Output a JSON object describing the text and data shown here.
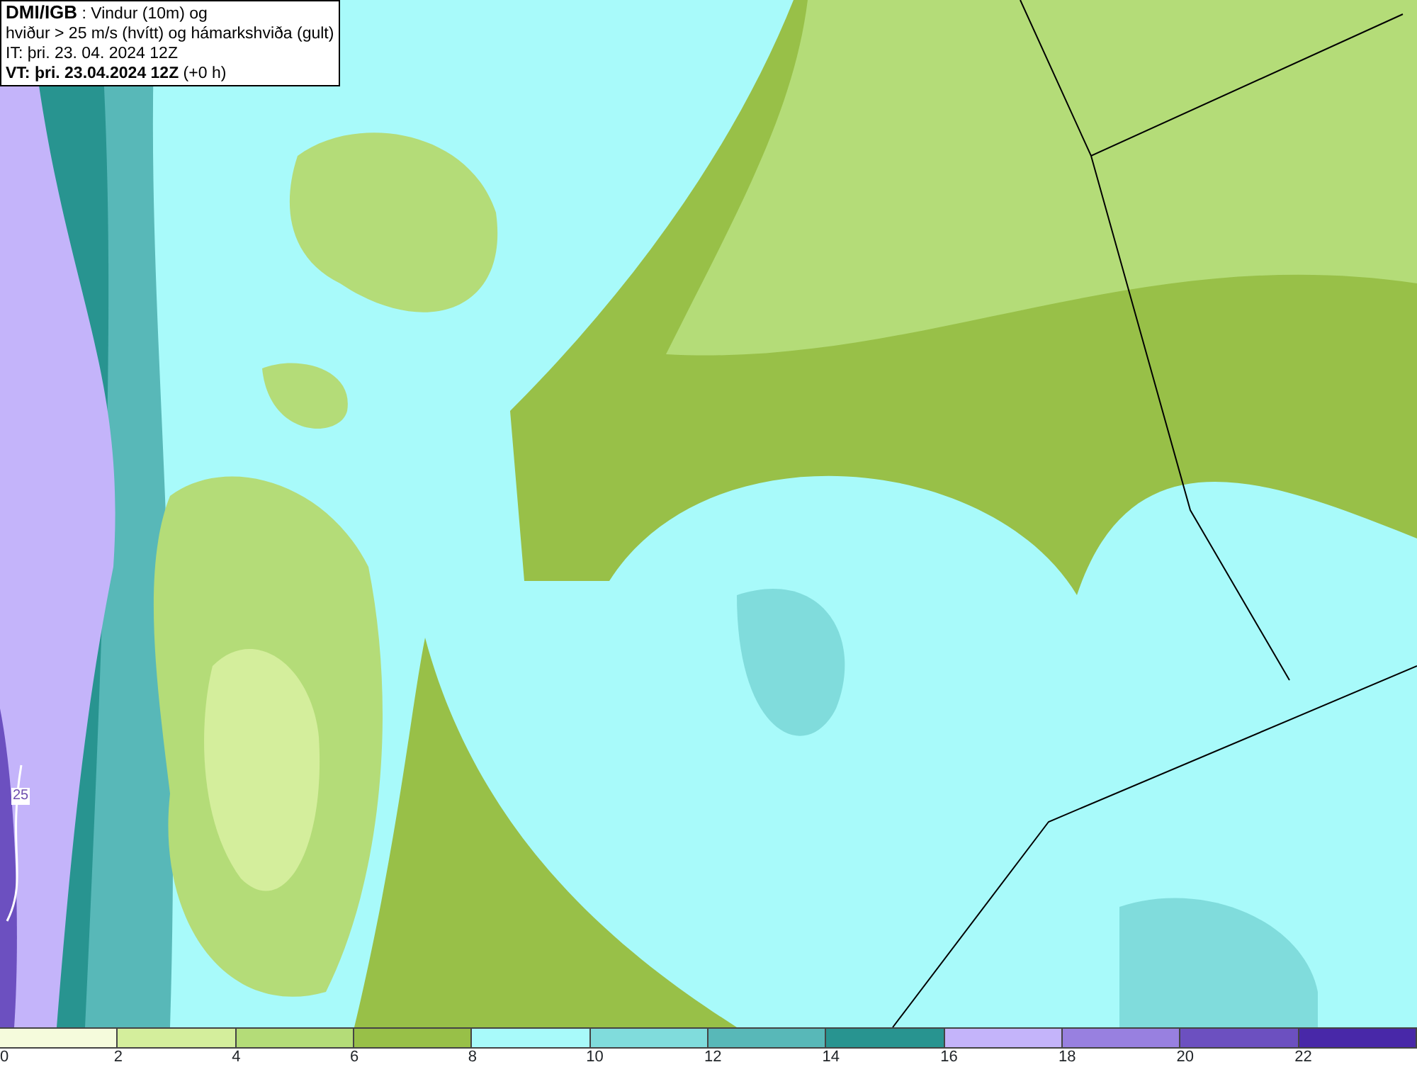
{
  "header": {
    "lines": [
      "**DMI/IGB** : Vindur (10m) og",
      "hviður > 25 m/s (hvítt) og hámarkshviða (gult)",
      "IT: þri. 23. 04. 2024 12Z",
      "**VT: þri. 23.04.2024 12Z** (+0 h)"
    ]
  },
  "map": {
    "contour_label": "25"
  },
  "legend": {
    "bins": [
      {
        "color": "#f5fbdc"
      },
      {
        "color": "#d4ee9c"
      },
      {
        "color": "#b4dc78"
      },
      {
        "color": "#98c048"
      },
      {
        "color": "#a8fafa"
      },
      {
        "color": "#80dcdc"
      },
      {
        "color": "#58b8b8"
      },
      {
        "color": "#289490"
      },
      {
        "color": "#c4b4fa"
      },
      {
        "color": "#9880e0"
      },
      {
        "color": "#6c50c0"
      },
      {
        "color": "#4828a8"
      }
    ],
    "ticks": [
      "0",
      "2",
      "4",
      "6",
      "8",
      "10",
      "12",
      "14",
      "16",
      "18",
      "20",
      "22"
    ]
  }
}
